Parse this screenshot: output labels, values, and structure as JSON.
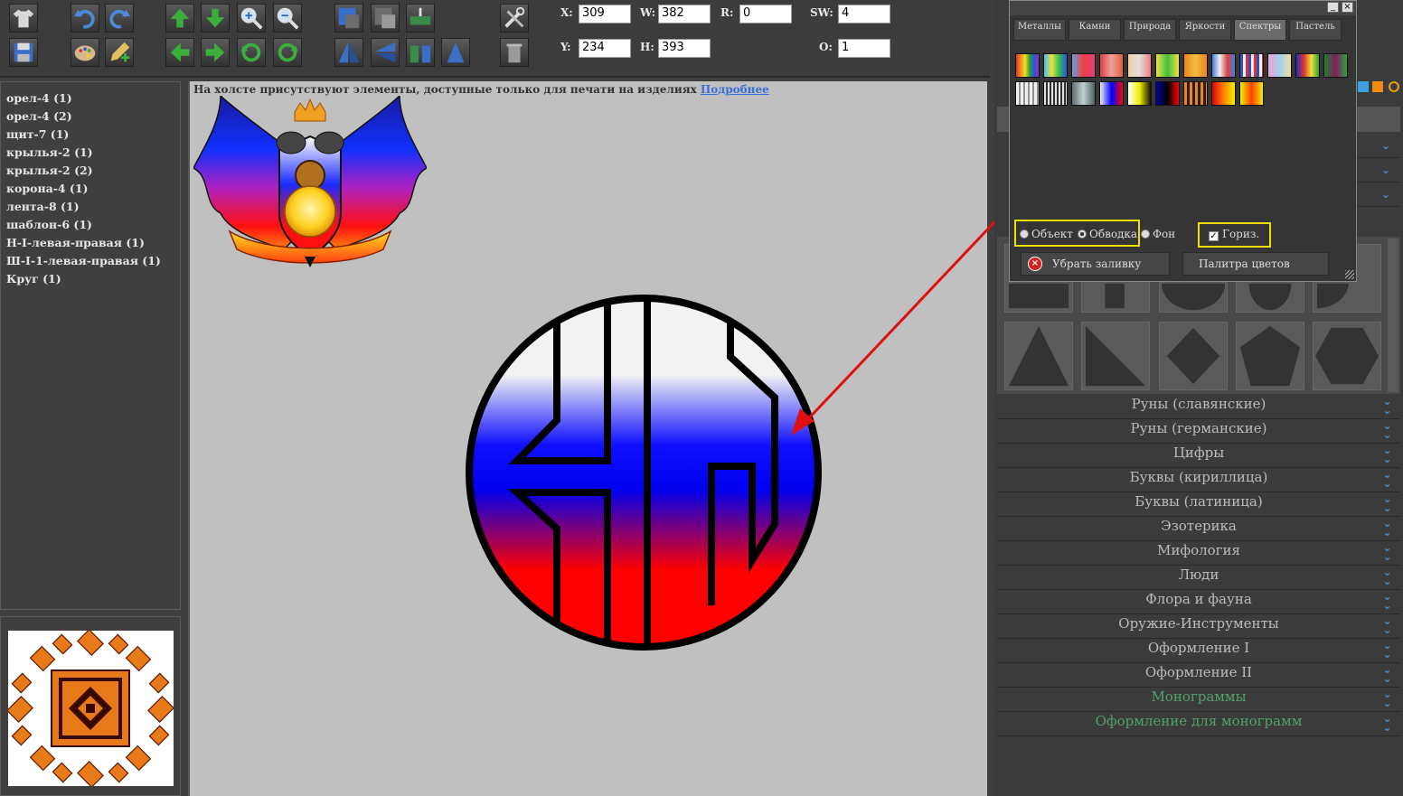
{
  "toolbar": {
    "fields": {
      "x": {
        "label": "X:",
        "value": "309"
      },
      "w": {
        "label": "W:",
        "value": "382"
      },
      "r": {
        "label": "R:",
        "value": "0"
      },
      "sw": {
        "label": "SW:",
        "value": "4"
      },
      "y": {
        "label": "Y:",
        "value": "234"
      },
      "h": {
        "label": "H:",
        "value": "393"
      },
      "o": {
        "label": "O:",
        "value": "1"
      }
    }
  },
  "layers": [
    "орел-4 (1)",
    "орел-4 (2)",
    "щит-7 (1)",
    "крылья-2 (1)",
    "крылья-2 (2)",
    "корона-4 (1)",
    "лента-8 (1)",
    "шаблон-6 (1)",
    "Н-I-левая-правая (1)",
    "Ш-I-1-левая-правая (1)",
    "Круг (1)"
  ],
  "canvas": {
    "notice": "На холсте присутствуют элементы, доступные только для печати на изделиях",
    "notice_link": "Подробнее"
  },
  "color_dialog": {
    "tabs": [
      "Металлы",
      "Камни",
      "Природа",
      "Яркости",
      "Спектры",
      "Пастель"
    ],
    "active_tab": "Спектры",
    "radio_object": "Объект",
    "radio_stroke": "Обводка",
    "radio_bg": "Фон",
    "checkbox_horiz": "Гориз.",
    "remove_fill": "Убрать заливку",
    "palette": "Палитра цветов"
  },
  "categories": [
    {
      "label": "Руны (славянские)",
      "color": "#bcbcbc"
    },
    {
      "label": "Руны (германские)",
      "color": "#bcbcbc"
    },
    {
      "label": "Цифры",
      "color": "#bcbcbc"
    },
    {
      "label": "Буквы (кириллица)",
      "color": "#bcbcbc"
    },
    {
      "label": "Буквы (латиница)",
      "color": "#bcbcbc"
    },
    {
      "label": "Эзотерика",
      "color": "#bcbcbc"
    },
    {
      "label": "Мифология",
      "color": "#bcbcbc"
    },
    {
      "label": "Люди",
      "color": "#bcbcbc"
    },
    {
      "label": "Флора и фауна",
      "color": "#bcbcbc"
    },
    {
      "label": "Оружие-Инструменты",
      "color": "#bcbcbc"
    },
    {
      "label": "Оформление I",
      "color": "#bcbcbc"
    },
    {
      "label": "Оформление II",
      "color": "#bcbcbc"
    },
    {
      "label": "Монограммы",
      "color": "#52a16a"
    },
    {
      "label": "Оформление для монограмм",
      "color": "#52a16a"
    }
  ],
  "colors": {
    "flag_white": "#ffffff",
    "flag_blue": "#0000ff",
    "flag_red": "#ff0000",
    "annotation_arrow": "#e01010",
    "highlight": "#f0e000"
  }
}
